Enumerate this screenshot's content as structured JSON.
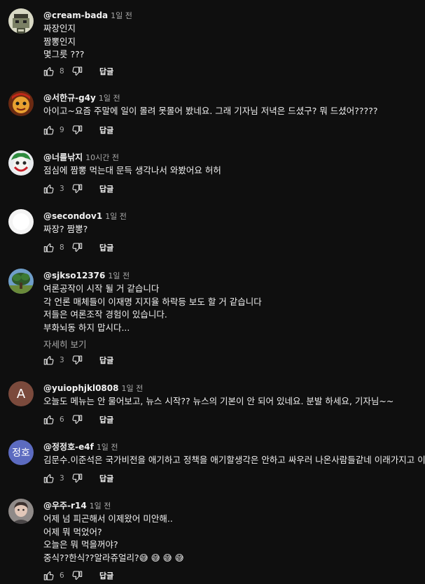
{
  "comments": [
    {
      "author": "@cream-bada",
      "time": "1일 전",
      "lines": [
        "짜장인지",
        "짬뽕인지",
        "몇그릇 ???"
      ],
      "likes": "8",
      "reply": "답글",
      "avatar": "pixel-avatar"
    },
    {
      "author": "@서한규-g4y",
      "time": "1일 전",
      "lines": [
        "아이고~요즘 주말에 일이 몰려 못몰어 봤네요. 그래 기자님 저녁은 드셨구? 뭐 드셨어?????"
      ],
      "likes": "9",
      "reply": "답글",
      "avatar": "cartoon-avatar"
    },
    {
      "author": "@너를낚지",
      "time": "10시간 전",
      "lines": [
        "점심에 짬뽕 먹는대 문득 생각나서 와봤어요 허허"
      ],
      "likes": "3",
      "reply": "답글",
      "avatar": "joker-avatar"
    },
    {
      "author": "@secondov1",
      "time": "1일 전",
      "lines": [
        "짜장? 짬뽕?"
      ],
      "likes": "8",
      "reply": "답글",
      "avatar": "blank-avatar"
    },
    {
      "author": "@sjkso12376",
      "time": "1일 전",
      "lines": [
        "여론공작이 시작 될 거 같습니다",
        "각 언론 매체들이 이재명 지지율 하락등 보도 할 거 같습니다",
        "저들은 여론조작 경험이 있습니다.",
        "부화뇌동 하지 맙시다..."
      ],
      "more": "자세히 보기",
      "likes": "3",
      "reply": "답글",
      "avatar": "tree-avatar"
    },
    {
      "author": "@yuiophjkl0808",
      "time": "1일 전",
      "lines": [
        "오늘도 메뉴는 안 물어보고, 뉴스 시작?? 뉴스의 기본이 안 되어 있네요. 분발 하세요, 기자님~~"
      ],
      "likes": "6",
      "reply": "답글",
      "avatar_text": "A",
      "avatar_color": "#7b4a3c"
    },
    {
      "author": "@정정호-e4f",
      "time": "1일 전",
      "lines": [
        "김문수.이준석은 국가비전을 애기하고 정책을 애기할생각은 안하고 싸우러 나온사람들같네 이래가지고 이길"
      ],
      "likes": "3",
      "reply": "답글",
      "avatar_text": "정호",
      "avatar_color": "#5c6bc0"
    },
    {
      "author": "@우주-r14",
      "time": "1일 전",
      "lines": [
        "어제 넘 피곤해서 이제왔어 미안해..",
        "어제 뭐 먹었어?",
        "오늘은 뭐 먹을꺼야?",
        "중식??한식??알라쥬얼리?😅 😅 😅 😅"
      ],
      "likes": "6",
      "reply": "답글",
      "avatar": "photo-avatar"
    }
  ]
}
